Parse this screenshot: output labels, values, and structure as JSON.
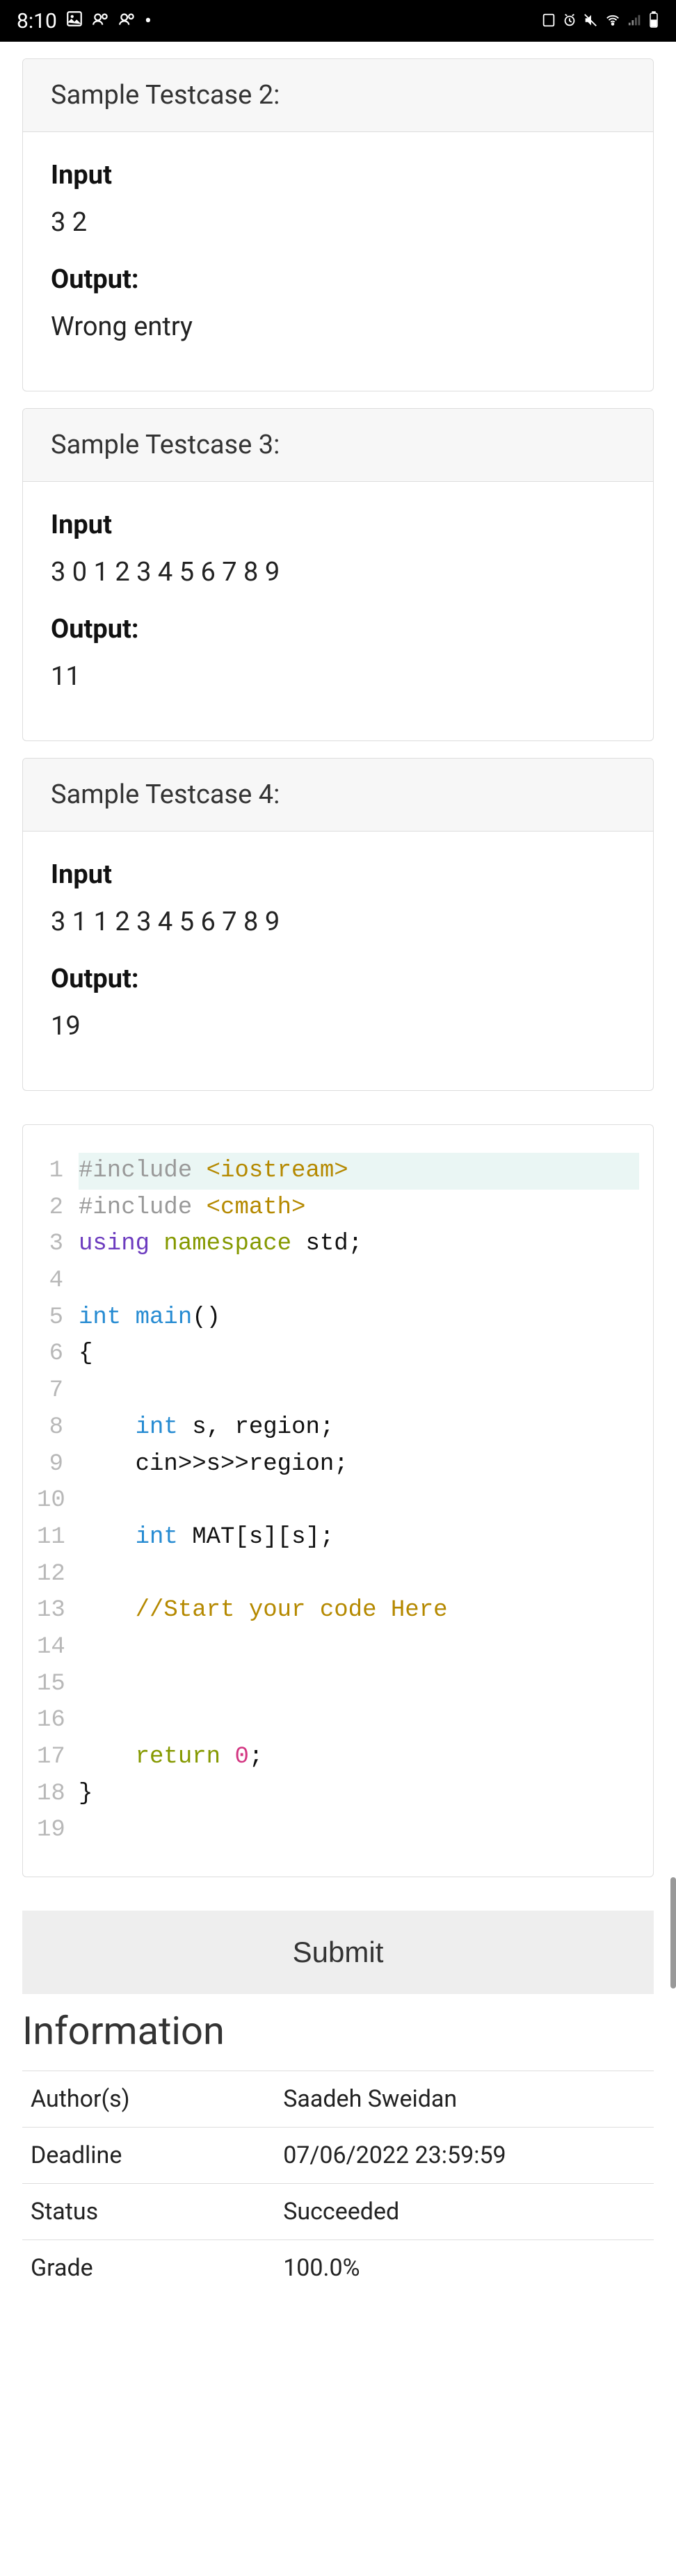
{
  "statusbar": {
    "time": "8:10",
    "dot": "•"
  },
  "testcases": [
    {
      "title": "Sample Testcase 2:",
      "input_label": "Input",
      "input": "3 2",
      "output_label": "Output:",
      "output": "Wrong entry"
    },
    {
      "title": "Sample Testcase 3:",
      "input_label": "Input",
      "input": "3 0 1 2 3 4 5 6 7 8 9",
      "output_label": "Output:",
      "output": "11"
    },
    {
      "title": "Sample Testcase 4:",
      "input_label": "Input",
      "input": "3 1 1 2 3 4 5 6 7 8 9",
      "output_label": "Output:",
      "output": "19"
    }
  ],
  "code": {
    "l1_a": "#include ",
    "l1_b": "<iostream>",
    "l2_a": "#include ",
    "l2_b": "<cmath>",
    "l3_a": "using",
    "l3_b": " namespace",
    "l3_c": " std;",
    "l5_a": "int",
    "l5_b": " ",
    "l5_c": "main",
    "l5_d": "()",
    "l6": "{",
    "l8_a": "    ",
    "l8_b": "int",
    "l8_c": " s, region;",
    "l9": "    cin>>s>>region;",
    "l11_a": "    ",
    "l11_b": "int",
    "l11_c": " MAT[s][s];",
    "l13_a": "    ",
    "l13_b": "//Start your code Here",
    "l17_a": "    ",
    "l17_b": "return",
    "l17_c": " ",
    "l17_d": "0",
    "l17_e": ";",
    "l18": "}"
  },
  "submit_label": "Submit",
  "info_title": "Information",
  "info": {
    "author_l": "Author(s)",
    "author_v": "Saadeh Sweidan",
    "deadline_l": "Deadline",
    "deadline_v": "07/06/2022 23:59:59",
    "status_l": "Status",
    "status_v": "Succeeded",
    "grade_l": "Grade",
    "grade_v": "100.0%"
  }
}
